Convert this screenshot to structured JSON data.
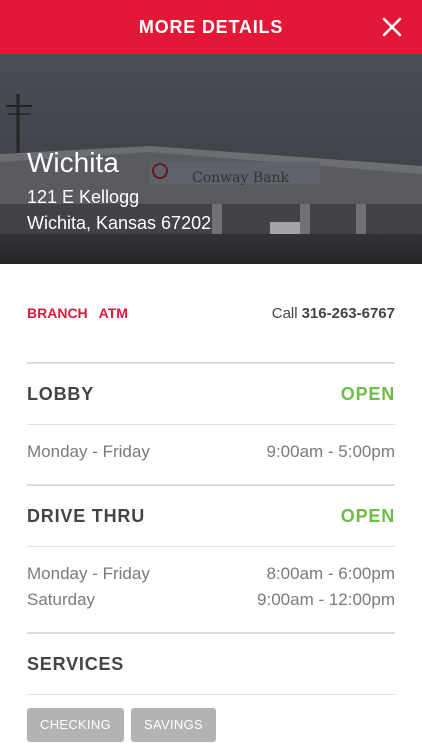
{
  "header": {
    "title": "MORE DETAILS",
    "close_icon": "close-icon"
  },
  "hero": {
    "city": "Wichita",
    "address_line1": "121 E Kellogg",
    "address_line2": "Wichita, Kansas 67202",
    "sign_text": "Conway Bank"
  },
  "location_types": [
    "BRANCH",
    "ATM"
  ],
  "call": {
    "label": "Call",
    "number": "316-263-6767"
  },
  "lobby": {
    "title": "LOBBY",
    "status": "OPEN",
    "hours": [
      {
        "days": "Monday - Friday",
        "time": "9:00am - 5:00pm"
      }
    ]
  },
  "drive_thru": {
    "title": "DRIVE THRU",
    "status": "OPEN",
    "hours": [
      {
        "days": "Monday - Friday",
        "time": "8:00am - 6:00pm"
      },
      {
        "days": "Saturday",
        "time": "9:00am - 12:00pm"
      }
    ]
  },
  "services": {
    "title": "SERVICES",
    "tags": [
      "CHECKING",
      "SAVINGS"
    ]
  },
  "colors": {
    "brand_red": "#e31837",
    "open_green": "#6cbd45",
    "tag_gray": "#b3b3b3"
  }
}
